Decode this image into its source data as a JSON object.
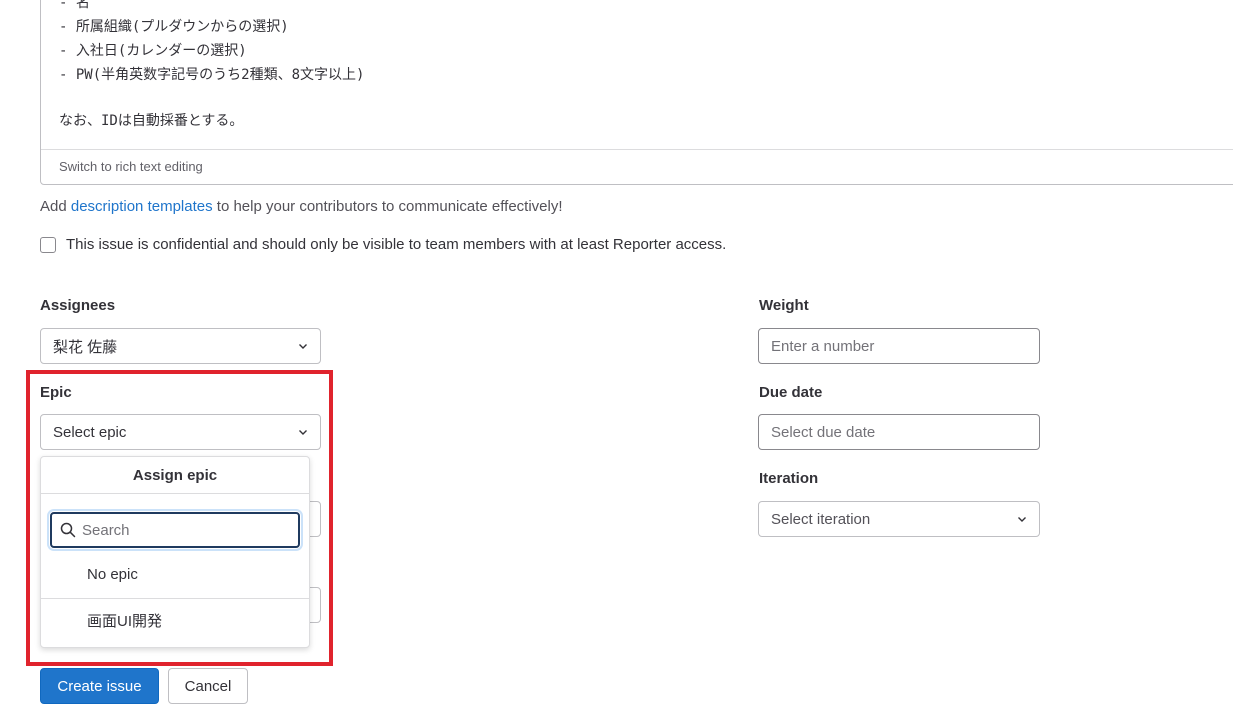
{
  "editor": {
    "lines": [
      "- 名",
      "- 所属組織(プルダウンからの選択)",
      "- 入社日(カレンダーの選択)",
      "- PW(半角英数字記号のうち2種類、8文字以上)",
      "",
      "なお、IDは自動採番とする。"
    ],
    "switch_label": "Switch to rich text editing"
  },
  "description_templates": {
    "prefix": "Add ",
    "link": "description templates",
    "suffix": " to help your contributors to communicate effectively!"
  },
  "confidential": {
    "label": "This issue is confidential and should only be visible to team members with at least Reporter access.",
    "checked": false
  },
  "assignees": {
    "label": "Assignees",
    "value": "梨花 佐藤"
  },
  "epic": {
    "label": "Epic",
    "value": "Select epic",
    "dropdown": {
      "header": "Assign epic",
      "search_placeholder": "Search",
      "items": [
        "No epic",
        "画面UI開発"
      ]
    }
  },
  "weight": {
    "label": "Weight",
    "placeholder": "Enter a number"
  },
  "due_date": {
    "label": "Due date",
    "placeholder": "Select due date"
  },
  "iteration": {
    "label": "Iteration",
    "value": "Select iteration"
  },
  "actions": {
    "create": "Create issue",
    "cancel": "Cancel"
  },
  "colors": {
    "primary": "#1f75cb",
    "highlight": "#e0232d",
    "border": "#bfbfc3"
  }
}
